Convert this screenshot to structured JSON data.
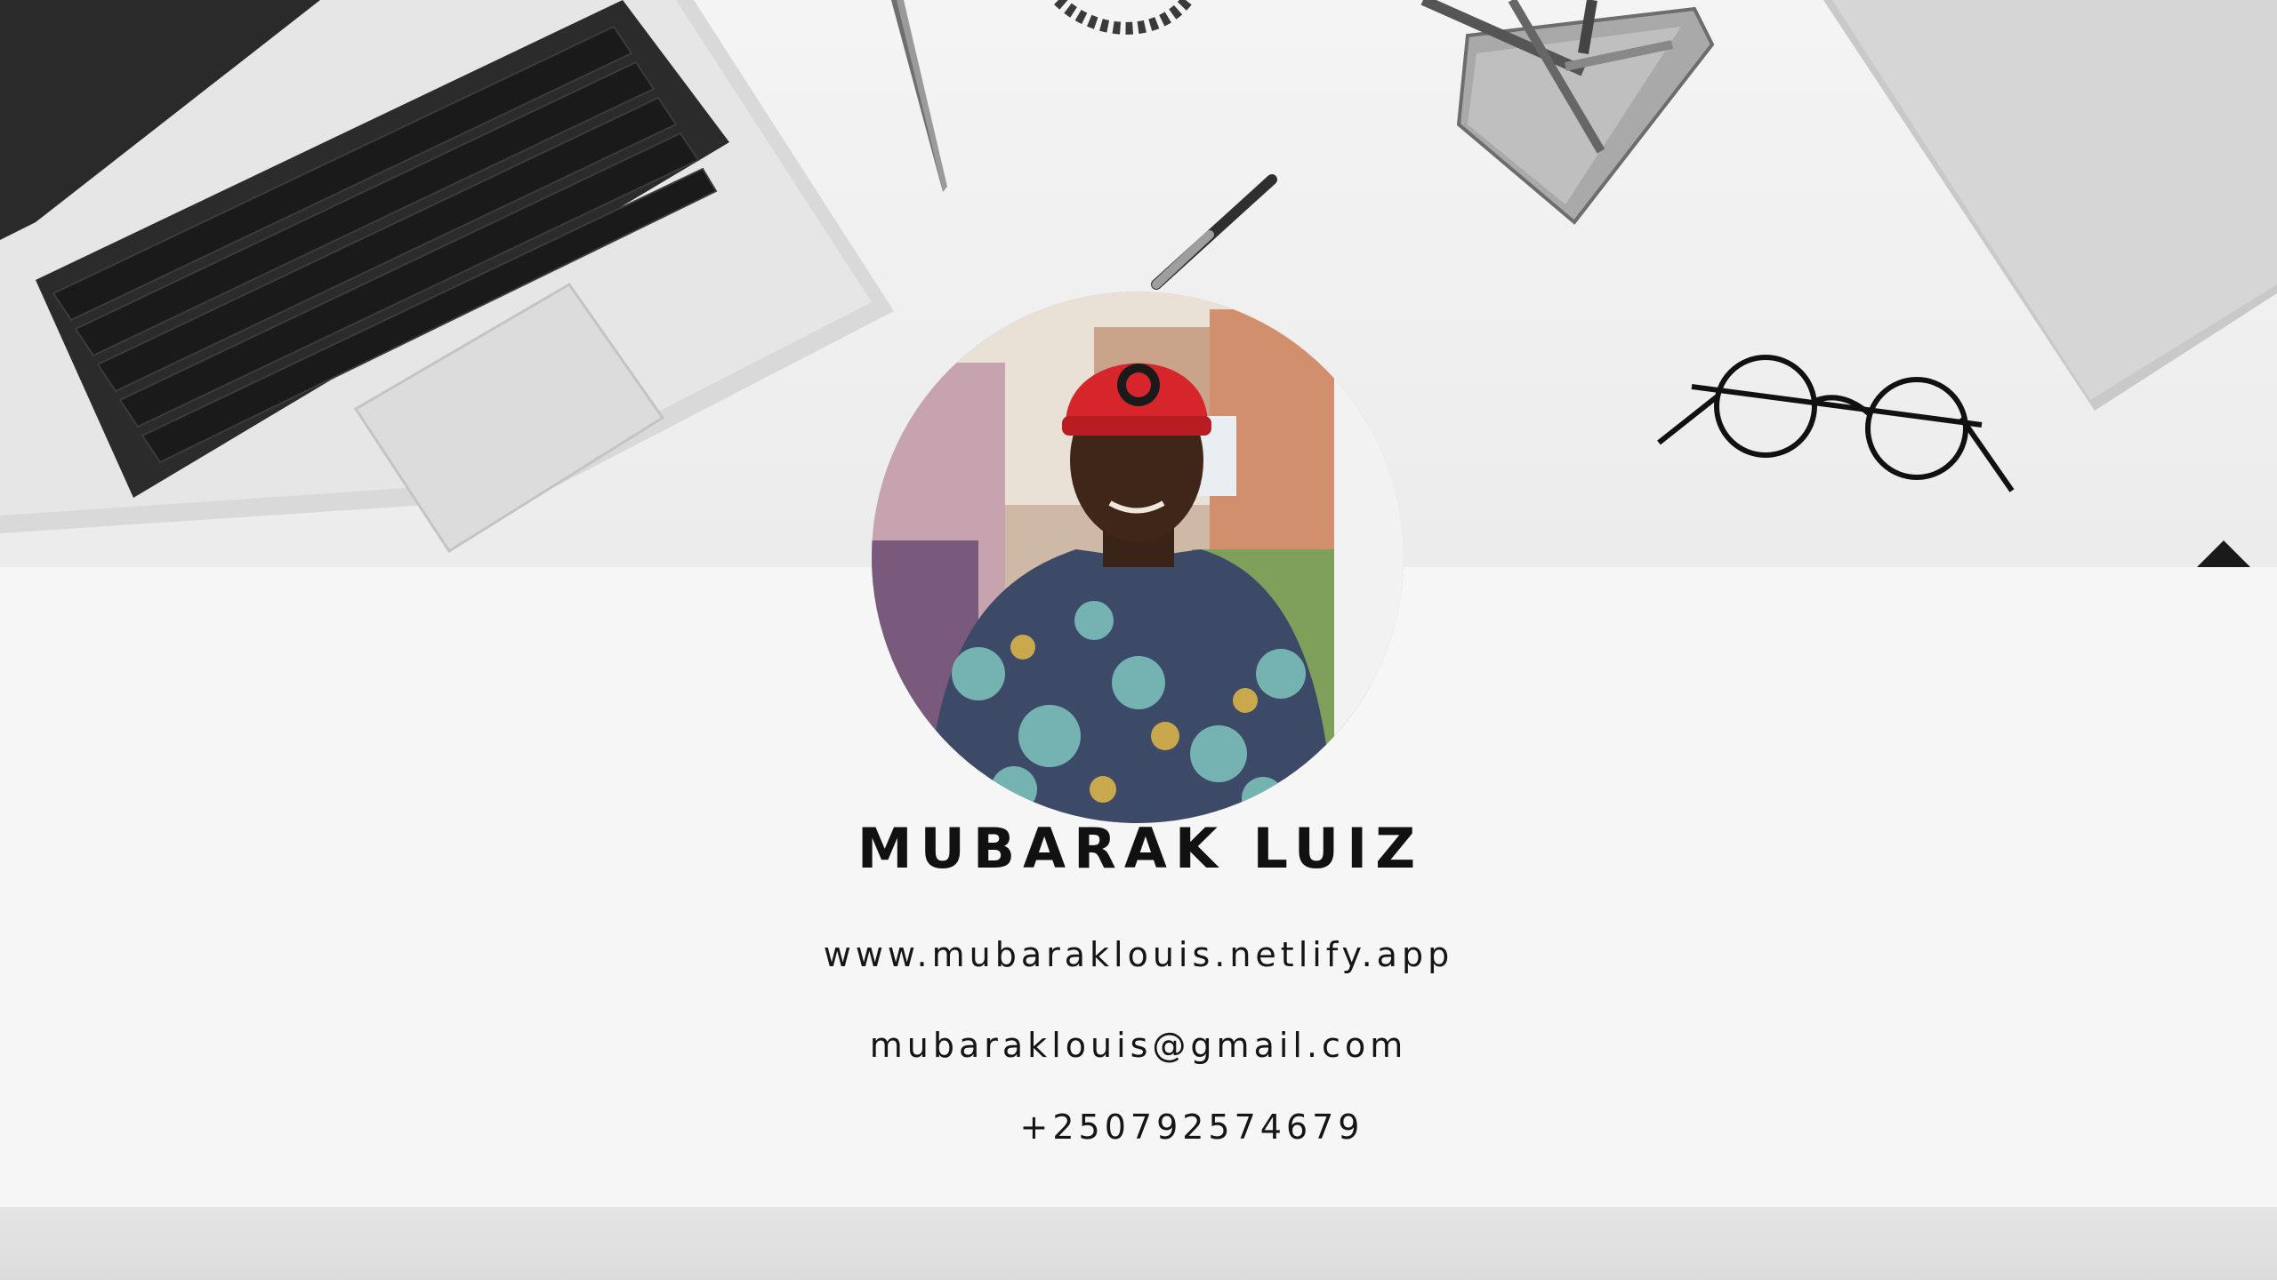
{
  "profile": {
    "name": "MUBARAK LUIZ",
    "website": "www.mubaraklouis.netlify.app",
    "email": "mubaraklouis@gmail.com",
    "phone": "+250792574679"
  },
  "colors": {
    "background": "#f6f6f6",
    "text": "#111111",
    "cap": "#d6262c"
  },
  "icons": {
    "laptop": "laptop-icon",
    "pen": "pen-icon",
    "glasses": "glasses-icon",
    "pen_holder": "pen-holder-icon"
  }
}
